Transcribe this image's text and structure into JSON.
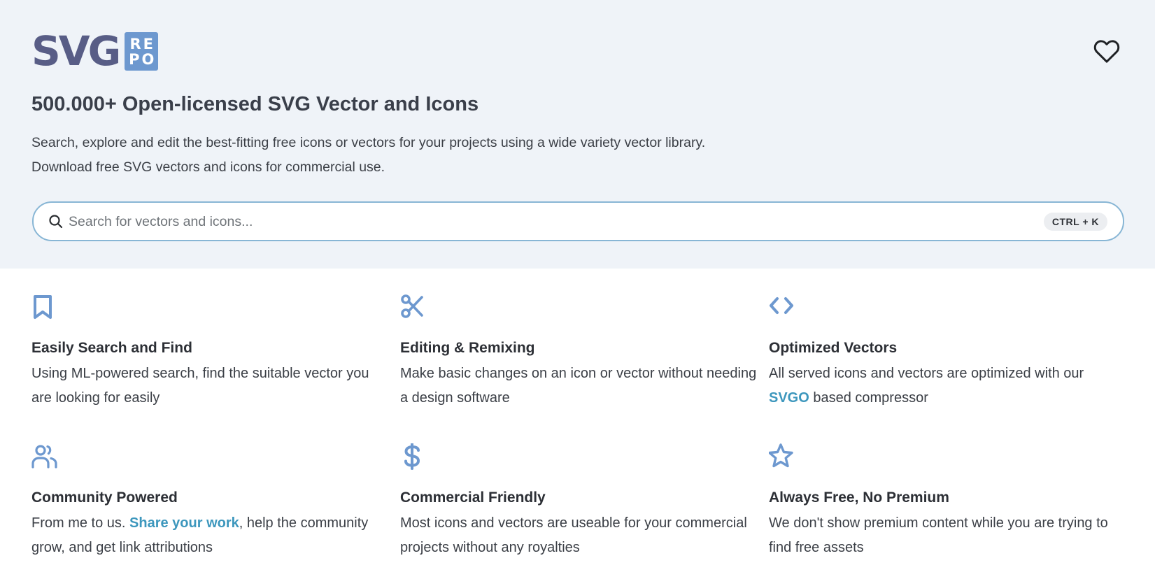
{
  "logo": {
    "word": "SVG",
    "box_line1": "RE",
    "box_line2": "PO"
  },
  "hero": {
    "title": "500.000+ Open-licensed SVG Vector and Icons",
    "subtitle_line1": "Search, explore and edit the best-fitting free icons or vectors for your projects using a wide variety vector library.",
    "subtitle_line2": "Download free SVG vectors and icons for commercial use."
  },
  "search": {
    "placeholder": "Search for vectors and icons...",
    "value": "",
    "shortcut": "CTRL + K"
  },
  "colors": {
    "accent": "#6d98cf",
    "link": "#3d97bd",
    "hero_bg": "#eff3f8",
    "logo_text": "#585d86"
  },
  "features": [
    {
      "icon": "bookmark-icon",
      "title": "Easily Search and Find",
      "desc_before": "Using ML-powered search, find the suitable vector you are looking for easily"
    },
    {
      "icon": "scissors-icon",
      "title": "Editing & Remixing",
      "desc_before": "Make basic changes on an icon or vector without needing a design software"
    },
    {
      "icon": "code-icon",
      "title": "Optimized Vectors",
      "desc_before": "All served icons and vectors are optimized with our ",
      "link": "SVGO",
      "desc_after": " based compressor"
    },
    {
      "icon": "users-icon",
      "title": "Community Powered",
      "desc_before": "From me to us. ",
      "link": "Share your work",
      "desc_after": ", help the community grow, and get link attributions"
    },
    {
      "icon": "dollar-icon",
      "title": "Commercial Friendly",
      "desc_before": "Most icons and vectors are useable for your commercial projects without any royalties"
    },
    {
      "icon": "star-icon",
      "title": "Always Free, No Premium",
      "desc_before": "We don't show premium content while you are trying to find free assets"
    }
  ]
}
